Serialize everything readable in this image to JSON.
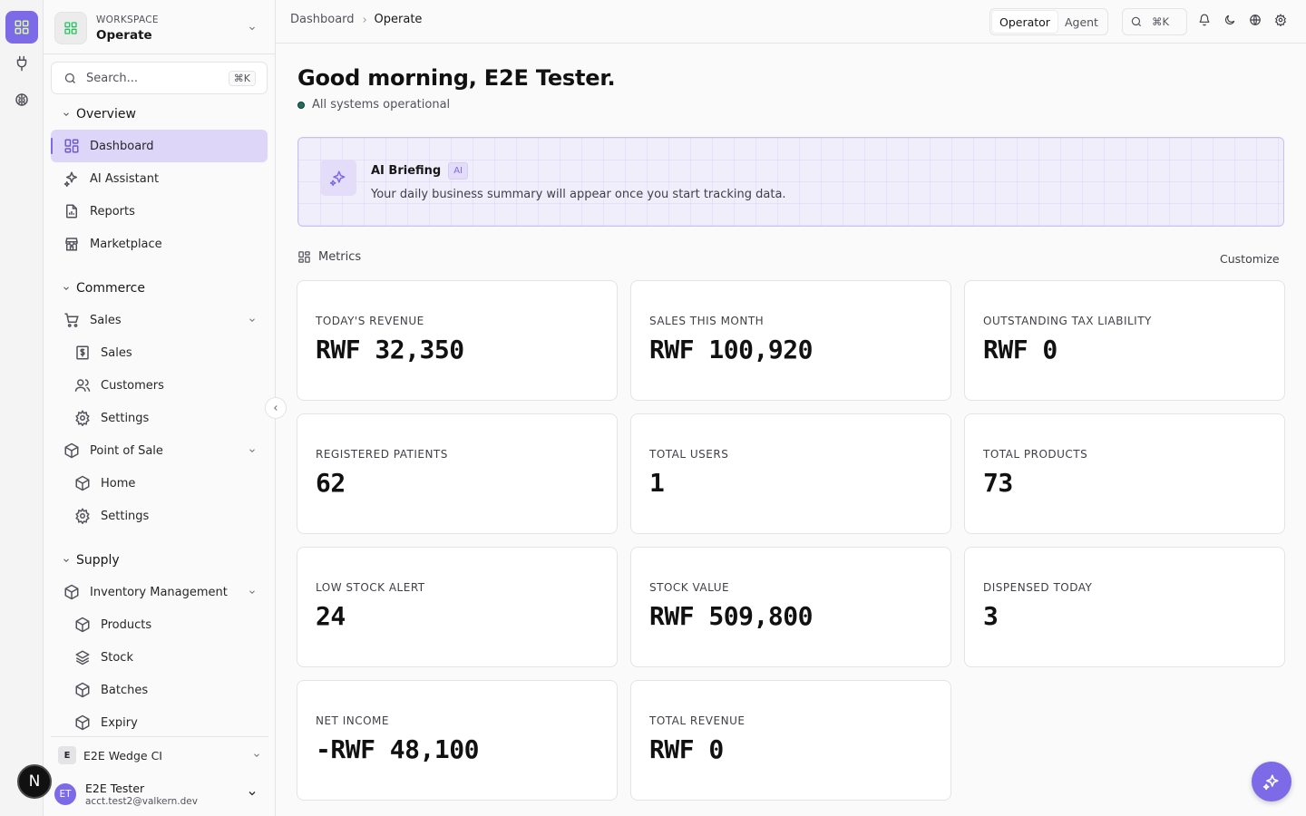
{
  "rail": {
    "items": [
      {
        "icon": "grid-icon",
        "active": true
      },
      {
        "icon": "plug-icon",
        "active": false
      },
      {
        "icon": "brain-icon",
        "active": false
      }
    ],
    "next_badge": "N"
  },
  "workspace": {
    "kicker": "WORKSPACE",
    "name": "Operate"
  },
  "sidebar": {
    "search_placeholder": "Search...",
    "search_shortcut": "⌘K",
    "groups": [
      {
        "label": "Overview",
        "items": [
          {
            "label": "Dashboard",
            "icon": "dashboard-icon",
            "active": true
          },
          {
            "label": "AI Assistant",
            "icon": "sparkles-icon"
          },
          {
            "label": "Reports",
            "icon": "report-icon"
          },
          {
            "label": "Marketplace",
            "icon": "store-icon"
          }
        ]
      },
      {
        "label": "Commerce",
        "items": [
          {
            "label": "Sales",
            "icon": "cart-icon",
            "expanded": true
          },
          {
            "label": "Sales",
            "icon": "receipt-icon"
          },
          {
            "label": "Customers",
            "icon": "users-icon"
          },
          {
            "label": "Settings",
            "icon": "gear-icon"
          },
          {
            "label": "Point of Sale",
            "icon": "box-icon",
            "expanded": true
          },
          {
            "label": "Home",
            "icon": "box-icon"
          },
          {
            "label": "Settings",
            "icon": "gear-icon"
          }
        ]
      },
      {
        "label": "Supply",
        "items": [
          {
            "label": "Inventory Management",
            "icon": "box-icon",
            "expanded": true
          },
          {
            "label": "Products",
            "icon": "box-icon"
          },
          {
            "label": "Stock",
            "icon": "layers-icon"
          },
          {
            "label": "Batches",
            "icon": "box-icon"
          },
          {
            "label": "Expiry",
            "icon": "box-icon"
          }
        ]
      }
    ],
    "org": {
      "initial": "E",
      "name": "E2E Wedge CI"
    },
    "user": {
      "initials": "ET",
      "name": "E2E Tester",
      "email": "acct.test2@valkern.dev"
    }
  },
  "topbar": {
    "breadcrumb": [
      "Dashboard",
      "Operate"
    ],
    "modes": [
      "Operator",
      "Agent"
    ],
    "active_mode": "Operator",
    "search_shortcut": "⌘K",
    "icons": [
      "bell-icon",
      "moon-icon",
      "globe-icon",
      "gear-icon"
    ]
  },
  "main": {
    "greeting": "Good morning, E2E Tester.",
    "status_text": "All systems operational",
    "status_color": "#1f6f5c",
    "briefing": {
      "title": "AI Briefing",
      "tag": "AI",
      "text": "Your daily business summary will appear once you start tracking data."
    },
    "metrics_title": "Metrics",
    "customize_label": "Customize",
    "cards": [
      {
        "label": "Today's Revenue",
        "value": "RWF 32,350"
      },
      {
        "label": "Sales This Month",
        "value": "RWF 100,920"
      },
      {
        "label": "Outstanding Tax Liability",
        "value": "RWF 0"
      },
      {
        "label": "Registered Patients",
        "value": "62"
      },
      {
        "label": "Total Users",
        "value": "1"
      },
      {
        "label": "Total Products",
        "value": "73"
      },
      {
        "label": "Low Stock Alert",
        "value": "24"
      },
      {
        "label": "Stock Value",
        "value": "RWF 509,800"
      },
      {
        "label": "Dispensed Today",
        "value": "3"
      },
      {
        "label": "Net Income",
        "value": "-RWF 48,100"
      },
      {
        "label": "Total Revenue",
        "value": "RWF 0"
      }
    ]
  },
  "accent_color": "#7c6ae6"
}
